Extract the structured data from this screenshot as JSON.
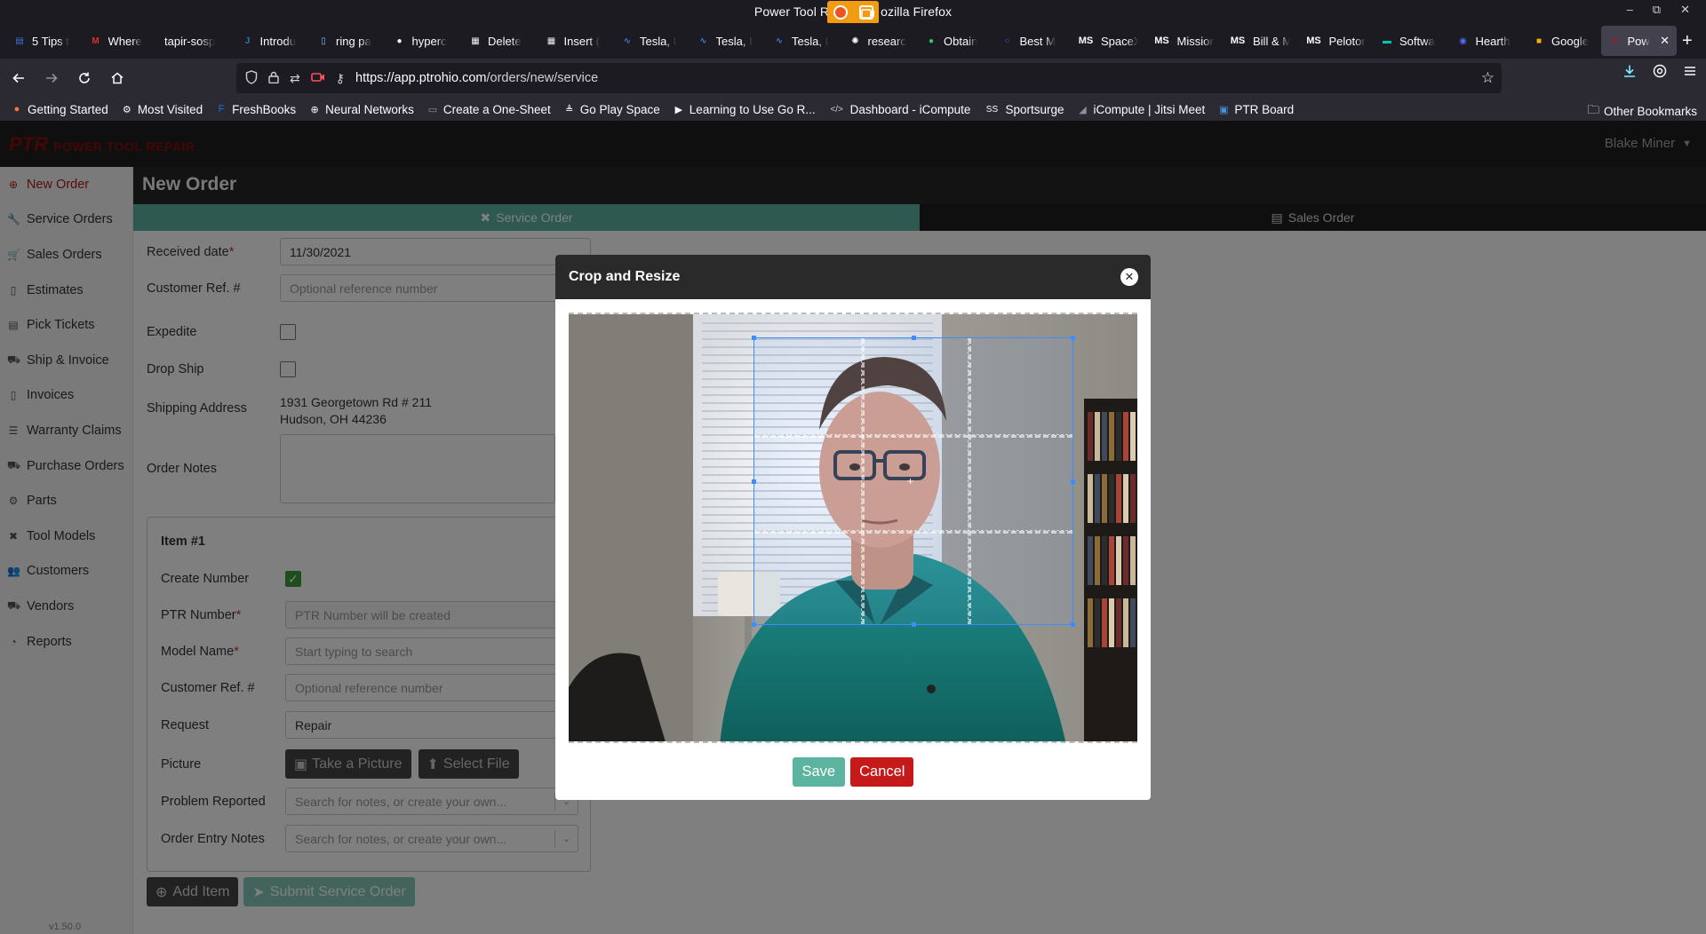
{
  "window": {
    "title": "Power Tool R… Mozilla Firefox",
    "title_left": "Power Tool R",
    "title_right": "ozilla Firefox"
  },
  "tabs": [
    {
      "label": "5 Tips t",
      "icon": "doc-icon",
      "color": "#3b74d8"
    },
    {
      "label": "Where",
      "icon": "gmail-icon",
      "color": "#d93025"
    },
    {
      "label": "tapir-sosp",
      "icon": "none",
      "color": "#1c1b22"
    },
    {
      "label": "Introdu",
      "icon": "jupyter-icon",
      "color": "#2a7ab0"
    },
    {
      "label": "ring pa",
      "icon": "file-icon",
      "color": "#7ab8e8"
    },
    {
      "label": "hyperc",
      "icon": "github-icon",
      "color": "#ffffff"
    },
    {
      "label": "Delete",
      "icon": "sheet-icon",
      "color": "#f0f0f0"
    },
    {
      "label": "Insert (",
      "icon": "sheet-icon",
      "color": "#f0f0f0"
    },
    {
      "label": "Tesla, I",
      "icon": "chart-icon",
      "color": "#2f80ed"
    },
    {
      "label": "Tesla, I",
      "icon": "chart-icon",
      "color": "#2f80ed"
    },
    {
      "label": "Tesla, I",
      "icon": "chart-icon",
      "color": "#2f80ed"
    },
    {
      "label": "researc",
      "icon": "openai-icon",
      "color": "#ffffff"
    },
    {
      "label": "Obtain",
      "icon": "leaf-icon",
      "color": "#2ecc71"
    },
    {
      "label": "Best M",
      "icon": "circle-icon",
      "color": "#3b5bdb"
    },
    {
      "label": "SpaceX",
      "icon": "ms-icon",
      "color": "#ffffff"
    },
    {
      "label": "Missior",
      "icon": "ms-icon",
      "color": "#ffffff"
    },
    {
      "label": "Bill & M",
      "icon": "ms-icon",
      "color": "#ffffff"
    },
    {
      "label": "Peloton",
      "icon": "ms-icon",
      "color": "#ffffff"
    },
    {
      "label": "Softwa",
      "icon": "hp-icon",
      "color": "#00c4a7"
    },
    {
      "label": "Hearth",
      "icon": "csl-icon",
      "color": "#4c6ef5"
    },
    {
      "label": "Google",
      "icon": "slides-icon",
      "color": "#f4b400"
    },
    {
      "label": "Pow",
      "icon": "ptr-icon",
      "color": "#b01818"
    }
  ],
  "tab_prefix": {
    "ms": "MS"
  },
  "url": {
    "host": "https://app.ptrohio.com",
    "path": "/orders/new/service"
  },
  "bookmarks": [
    {
      "label": "Getting Started",
      "icon": "firefox-icon"
    },
    {
      "label": "Most Visited",
      "icon": "gear-icon"
    },
    {
      "label": "FreshBooks",
      "icon": "freshbooks-icon"
    },
    {
      "label": "Neural Networks",
      "icon": "globe-icon"
    },
    {
      "label": "Create a One-Sheet",
      "icon": "doc-icon"
    },
    {
      "label": "Go Play Space",
      "icon": "go-icon"
    },
    {
      "label": "Learning to Use Go R...",
      "icon": "video-icon"
    },
    {
      "label": "Dashboard - iCompute",
      "icon": "code-icon"
    },
    {
      "label": "Sportsurge",
      "icon": "ss-icon"
    },
    {
      "label": "iCompute | Jitsi Meet",
      "icon": "jitsi-icon"
    },
    {
      "label": "PTR Board",
      "icon": "board-icon"
    }
  ],
  "bookmarks_other": "Other Bookmarks",
  "app": {
    "logo_abbr": "PTR",
    "logo_name": "POWER TOOL REPAIR",
    "user": "Blake Miner",
    "version": "v1.50.0",
    "page_title": "New Order",
    "order_tabs": {
      "service": "Service Order",
      "sales": "Sales Order"
    }
  },
  "sidebar": [
    {
      "label": "New Order",
      "icon": "plus-circle-icon",
      "active": true
    },
    {
      "label": "Service Orders",
      "icon": "wrench-icon"
    },
    {
      "label": "Sales Orders",
      "icon": "cart-icon"
    },
    {
      "label": "Estimates",
      "icon": "file-icon"
    },
    {
      "label": "Pick Tickets",
      "icon": "file-text-icon"
    },
    {
      "label": "Ship & Invoice",
      "icon": "truck-icon"
    },
    {
      "label": "Invoices",
      "icon": "file-icon"
    },
    {
      "label": "Warranty Claims",
      "icon": "list-icon"
    },
    {
      "label": "Purchase Orders",
      "icon": "truck-icon"
    },
    {
      "label": "Parts",
      "icon": "cogs-icon"
    },
    {
      "label": "Tool Models",
      "icon": "tools-icon"
    },
    {
      "label": "Customers",
      "icon": "users-icon"
    },
    {
      "label": "Vendors",
      "icon": "truck-icon"
    },
    {
      "label": "Reports",
      "icon": "pie-chart-icon"
    }
  ],
  "form": {
    "received_date_label": "Received date",
    "received_date_value": "11/30/2021",
    "customer_ref_label": "Customer Ref. #",
    "customer_ref_placeholder": "Optional reference number",
    "expedite_label": "Expedite",
    "drop_ship_label": "Drop Ship",
    "shipping_address_label": "Shipping Address",
    "shipping_address_line1": "1931 Georgetown Rd # 211",
    "shipping_address_line2": "Hudson, OH 44236",
    "order_notes_label": "Order Notes",
    "required_mark": "*"
  },
  "item": {
    "title": "Item #1",
    "create_number_label": "Create Number",
    "ptr_number_label": "PTR Number",
    "ptr_number_placeholder": "PTR Number will be created",
    "model_name_label": "Model Name",
    "model_name_placeholder": "Start typing to search",
    "customer_ref_label": "Customer Ref. #",
    "customer_ref_placeholder": "Optional reference number",
    "request_label": "Request",
    "request_value": "Repair",
    "picture_label": "Picture",
    "take_picture": "Take a Picture",
    "select_file": "Select File",
    "problem_label": "Problem Reported",
    "problem_placeholder": "Search for notes, or create your own...",
    "entry_notes_label": "Order Entry Notes",
    "entry_notes_placeholder": "Search for notes, or create your own..."
  },
  "buttons": {
    "add_item": "Add Item",
    "submit": "Submit Service Order"
  },
  "modal": {
    "title": "Crop and Resize",
    "save": "Save",
    "cancel": "Cancel"
  },
  "colors": {
    "accent_teal": "#5cb3a0",
    "cancel_red": "#c61a1a",
    "brand_red": "#b01818",
    "crop_blue": "#3c8dff"
  }
}
